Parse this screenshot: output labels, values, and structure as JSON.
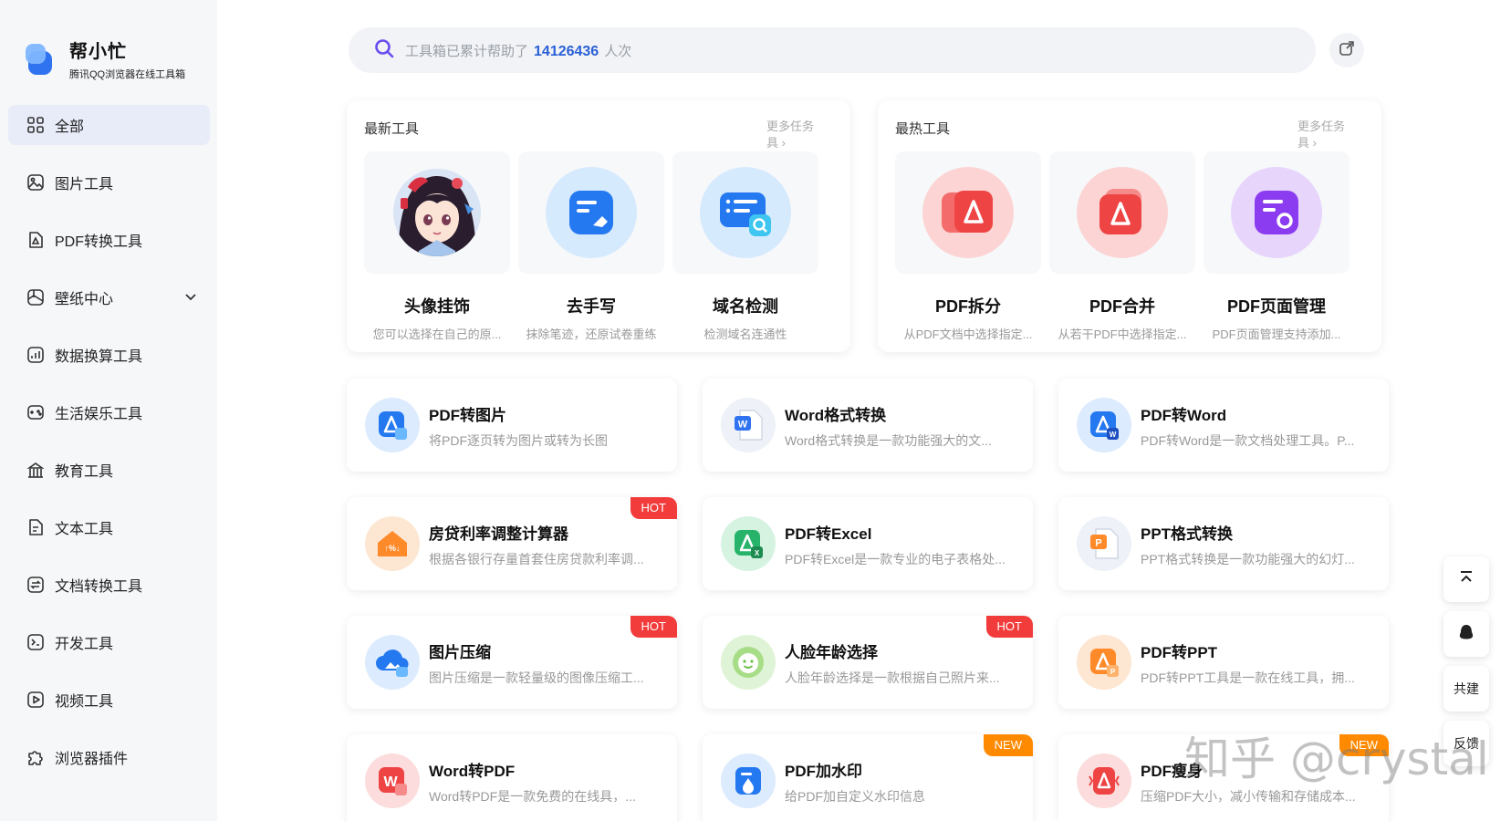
{
  "brand": {
    "name": "帮小忙",
    "subtitle": "腾讯QQ浏览器在线工具箱"
  },
  "nav": {
    "items": [
      {
        "label": "全部",
        "icon": "grid-icon",
        "active": true
      },
      {
        "label": "图片工具",
        "icon": "image-icon"
      },
      {
        "label": "PDF转换工具",
        "icon": "pdf-icon"
      },
      {
        "label": "壁纸中心",
        "icon": "wallpaper-icon",
        "expandable": true
      },
      {
        "label": "数据换算工具",
        "icon": "chart-icon"
      },
      {
        "label": "生活娱乐工具",
        "icon": "game-icon"
      },
      {
        "label": "教育工具",
        "icon": "school-icon"
      },
      {
        "label": "文本工具",
        "icon": "text-icon"
      },
      {
        "label": "文档转换工具",
        "icon": "doc-convert-icon"
      },
      {
        "label": "开发工具",
        "icon": "terminal-icon"
      },
      {
        "label": "视频工具",
        "icon": "video-icon"
      },
      {
        "label": "浏览器插件",
        "icon": "puzzle-icon"
      }
    ]
  },
  "search": {
    "prefix": "工具箱已累计帮助了",
    "count": "14126436",
    "suffix": "人次"
  },
  "panels": {
    "latest": {
      "title": "最新工具",
      "more": "更多任务具 ›",
      "items": [
        {
          "title": "头像挂饰",
          "desc": "您可以选择在自己的原..."
        },
        {
          "title": "去手写",
          "desc": "抹除笔迹，还原试卷重练"
        },
        {
          "title": "域名检测",
          "desc": "检测域名连通性"
        }
      ]
    },
    "hot": {
      "title": "最热工具",
      "more": "更多任务具 ›",
      "items": [
        {
          "title": "PDF拆分",
          "desc": "从PDF文档中选择指定..."
        },
        {
          "title": "PDF合并",
          "desc": "从若干PDF中选择指定..."
        },
        {
          "title": "PDF页面管理",
          "desc": "PDF页面管理支持添加..."
        }
      ]
    }
  },
  "tools": [
    {
      "title": "PDF转图片",
      "desc": "将PDF逐页转为图片或转为长图",
      "badge": ""
    },
    {
      "title": "Word格式转换",
      "desc": "Word格式转换是一款功能强大的文...",
      "badge": ""
    },
    {
      "title": "PDF转Word",
      "desc": "PDF转Word是一款文档处理工具。P...",
      "badge": ""
    },
    {
      "title": "房贷利率调整计算器",
      "desc": "根据各银行存量首套住房贷款利率调...",
      "badge": "HOT"
    },
    {
      "title": "PDF转Excel",
      "desc": "PDF转Excel是一款专业的电子表格处...",
      "badge": ""
    },
    {
      "title": "PPT格式转换",
      "desc": "PPT格式转换是一款功能强大的幻灯...",
      "badge": ""
    },
    {
      "title": "图片压缩",
      "desc": "图片压缩是一款轻量级的图像压缩工...",
      "badge": "HOT"
    },
    {
      "title": "人脸年龄选择",
      "desc": "人脸年龄选择是一款根据自己照片来...",
      "badge": "HOT"
    },
    {
      "title": "PDF转PPT",
      "desc": "PDF转PPT工具是一款在线工具，拥...",
      "badge": ""
    },
    {
      "title": "Word转PDF",
      "desc": "Word转PDF是一款免费的在线具，...",
      "badge": ""
    },
    {
      "title": "PDF加水印",
      "desc": "给PDF加自定义水印信息",
      "badge": "NEW"
    },
    {
      "title": "PDF瘦身",
      "desc": "压缩PDF大小，减小传输和存储成本...",
      "badge": "NEW"
    }
  ],
  "float": {
    "cobuild": "共建",
    "feedback": "反馈"
  },
  "watermark": "知乎 @crystal",
  "colors": {
    "accent": "#2f73f0",
    "hot": "#f23c3c",
    "new": "#ff8a00",
    "search_count": "#2a5fd6"
  }
}
